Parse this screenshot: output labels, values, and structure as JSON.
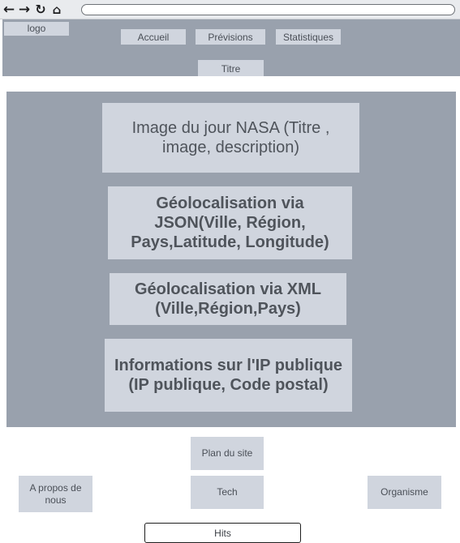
{
  "browser": {
    "back_icon": "←",
    "forward_icon": "→",
    "reload_icon": "↻",
    "home_icon": "⌂",
    "url": ""
  },
  "header": {
    "logo": "logo",
    "nav": {
      "home": "Accueil",
      "forecasts": "Prévisions",
      "statistics": "Statistiques"
    },
    "title": "Titre"
  },
  "main": {
    "nasa": "Image du jour NASA (Titre , image, description)",
    "json_geo": "Géolocalisation via JSON(Ville, Région, Pays,Latitude, Longitude)",
    "xml_geo": "Géolocalisation via XML (Ville,Région,Pays)",
    "ip_info": "Informations sur l'IP publique (IP publique, Code postal)"
  },
  "footer": {
    "sitemap": "Plan du site",
    "tech": "Tech",
    "about": "A propos de nous",
    "organization": "Organisme",
    "hits": "Hits"
  },
  "colors": {
    "panel": "#99a1ad",
    "box": "#d0d5de",
    "text": "#4a4f57"
  }
}
